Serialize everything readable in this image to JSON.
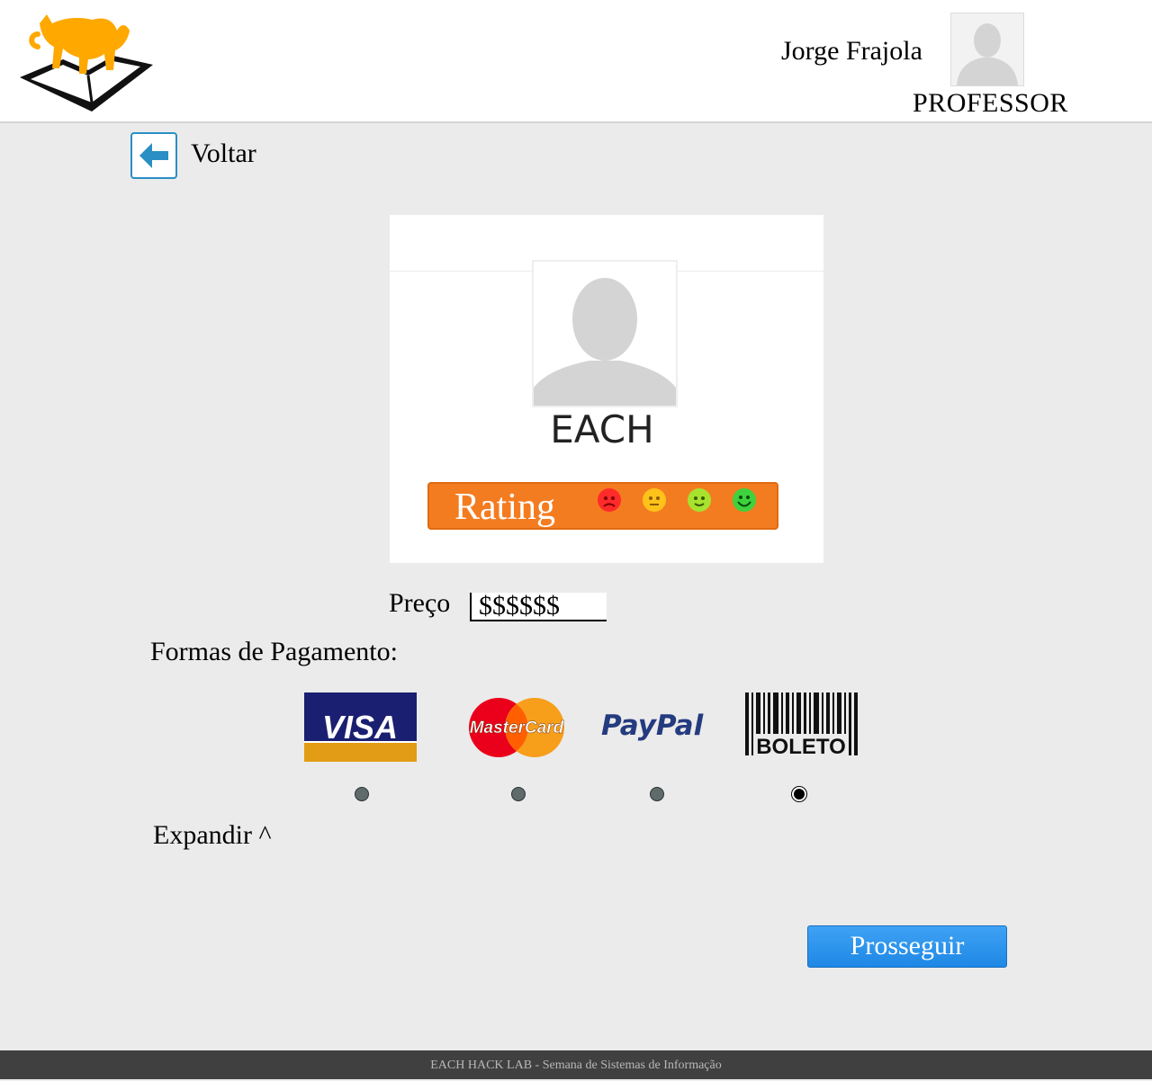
{
  "header": {
    "user_name": "Jorge Frajola",
    "user_role": "PROFESSOR",
    "logo_icon": "cat-on-book-logo"
  },
  "navigation": {
    "back_label": "Voltar",
    "back_icon": "arrow-left-icon"
  },
  "card": {
    "name": "EACH",
    "rating_label": "Rating",
    "rating_faces": [
      {
        "color": "#ff2a2a",
        "icon": "angry-face-icon"
      },
      {
        "color": "#ffc21a",
        "icon": "neutral-face-icon"
      },
      {
        "color": "#a6e22e",
        "icon": "smile-face-icon"
      },
      {
        "color": "#3ed23e",
        "icon": "big-smile-face-icon"
      }
    ]
  },
  "price": {
    "label": "Preço",
    "value": "$$$$$$"
  },
  "payment": {
    "title": "Formas de Pagamento:",
    "methods": [
      {
        "name": "VISA",
        "icon": "visa-logo",
        "selected": false
      },
      {
        "name": "MasterCard",
        "icon": "mastercard-logo",
        "selected": false
      },
      {
        "name": "PayPal",
        "icon": "paypal-logo",
        "selected": false
      },
      {
        "name": "BOLETO",
        "icon": "boleto-barcode-logo",
        "selected": true
      }
    ]
  },
  "expand_label": "Expandir ^",
  "proceed_label": "Prosseguir",
  "footer_text": "EACH HACK LAB - Semana de Sistemas de Informação",
  "colors": {
    "accent_blue": "#1e88e5",
    "back_border": "#2a8fc4",
    "rating_orange": "#f47c20",
    "logo_orange": "#ffa800",
    "footer_bg": "#404040",
    "page_bg": "#ebebeb"
  }
}
